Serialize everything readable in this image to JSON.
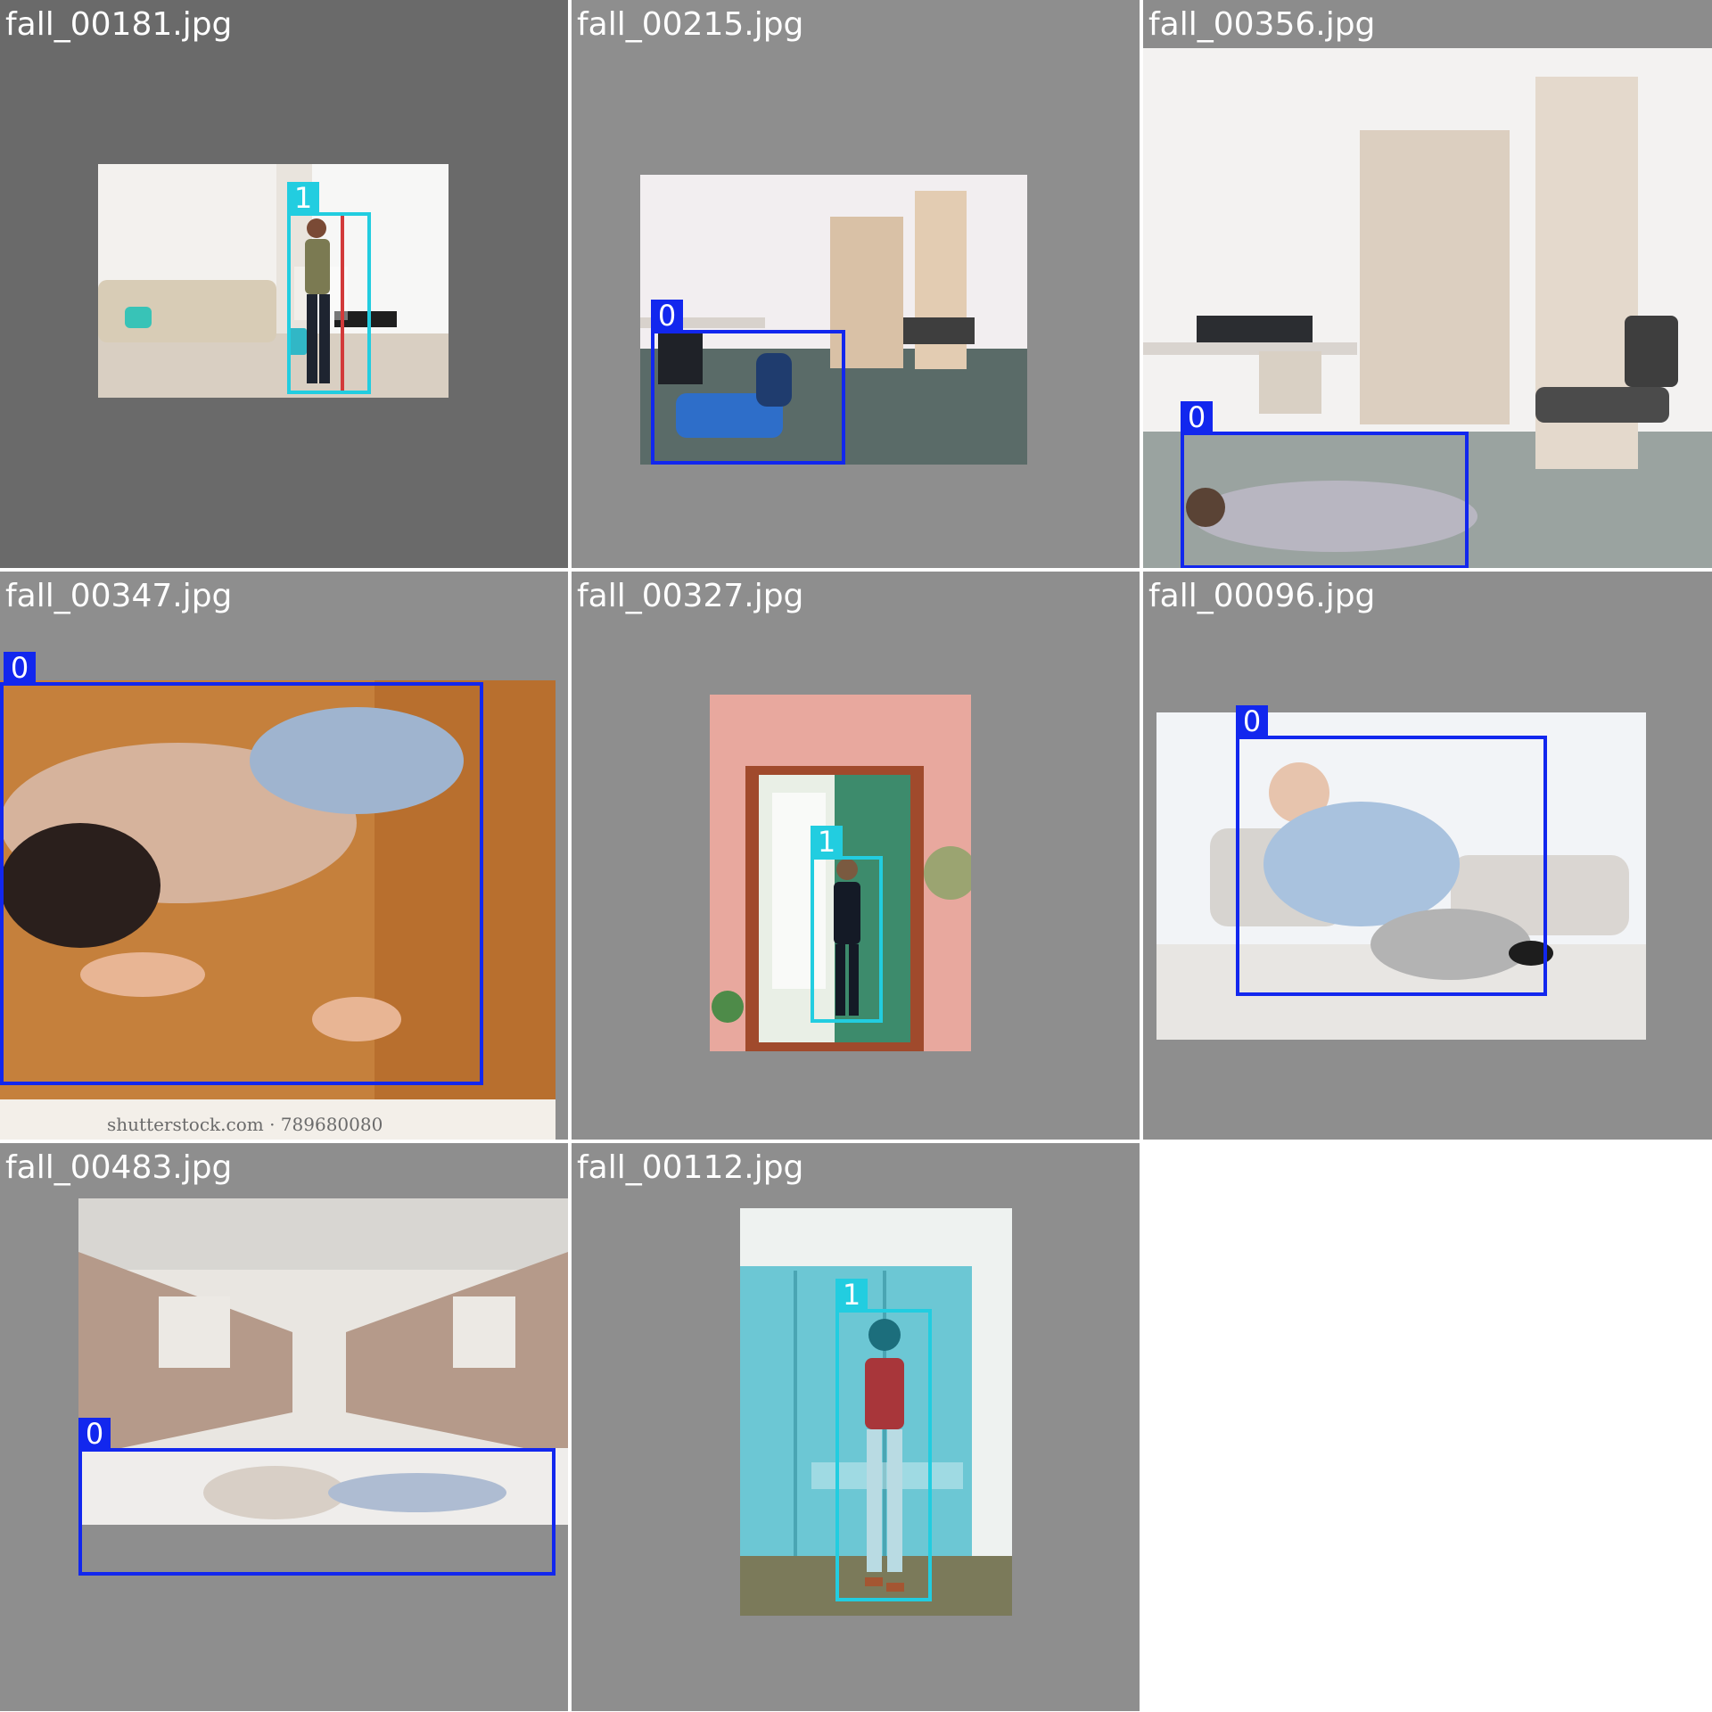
{
  "colors": {
    "class0": "#1227ee",
    "class1": "#22cde0",
    "tile_dark": "#6a6a6a",
    "tile_gray": "#8e8e8e"
  },
  "tiles": [
    {
      "filename": "fall_00181.jpg",
      "boxes": [
        {
          "label": "1"
        }
      ]
    },
    {
      "filename": "fall_00215.jpg",
      "boxes": [
        {
          "label": "0"
        }
      ]
    },
    {
      "filename": "fall_00356.jpg",
      "boxes": [
        {
          "label": "0"
        }
      ]
    },
    {
      "filename": "fall_00347.jpg",
      "boxes": [
        {
          "label": "0"
        }
      ],
      "watermark": "shutterstock.com · 789680080"
    },
    {
      "filename": "fall_00327.jpg",
      "boxes": [
        {
          "label": "1"
        }
      ]
    },
    {
      "filename": "fall_00096.jpg",
      "boxes": [
        {
          "label": "0"
        }
      ]
    },
    {
      "filename": "fall_00483.jpg",
      "boxes": [
        {
          "label": "0"
        }
      ]
    },
    {
      "filename": "fall_00112.jpg",
      "boxes": [
        {
          "label": "1"
        }
      ]
    }
  ]
}
